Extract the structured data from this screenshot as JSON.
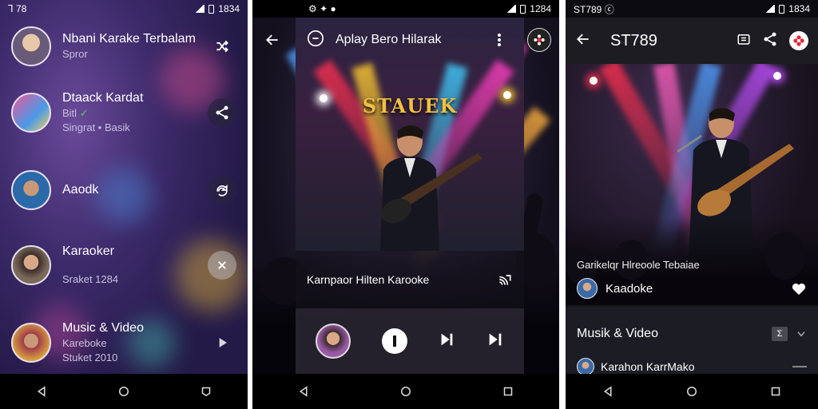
{
  "colors": {
    "accent_red": "#e8283c",
    "poster_gold": "#f0c040",
    "nav_bar": "#000000",
    "panel3_bg": "#15151c"
  },
  "panel1": {
    "status_time": "ꓶ 78",
    "status_time_2": "1834",
    "items": [
      {
        "title": "Nbani Karake Terbalam",
        "subtitle": "Spror",
        "action_icon": "shuffle-icon"
      },
      {
        "title": "Dtaack Kardat",
        "subtitle": "Bitl",
        "subtitle2": "Singrat • Basik",
        "action_icon": "share-icon"
      },
      {
        "title": "Aaodk",
        "action_icon": "refresh-icon"
      },
      {
        "title": "Karaoker",
        "subtitle": "Sraket 1284",
        "action_icon": "close-icon"
      },
      {
        "title": "Music & Video",
        "subtitle": "Kareboke",
        "subtitle2": "Stuket 2010",
        "action_icon": "play-icon"
      }
    ]
  },
  "panel2": {
    "status_time": "1284",
    "header_title": "Aplay Bero Hilarak",
    "poster_title": "STAUEK",
    "caption": "Karnpaor Hilten Karooke"
  },
  "panel3": {
    "status_left": "ST789",
    "status_time": "1834",
    "header_title": "ST789",
    "concert_caption": "Garikelqr Hlreoole Tebaiae",
    "artist_row_label": "Kaadoke",
    "section_title": "Musik & Video",
    "last_row_label": "Karahon KarrMako"
  }
}
